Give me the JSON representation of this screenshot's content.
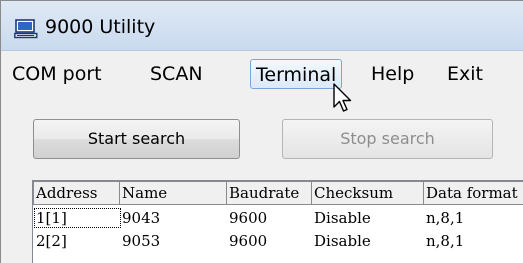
{
  "window": {
    "title": "9000 Utility",
    "app_icon": "computer-icon"
  },
  "menu": {
    "items": [
      {
        "label": "COM port"
      },
      {
        "label": "SCAN"
      },
      {
        "label": "Terminal",
        "hovered": true
      },
      {
        "label": "Help"
      },
      {
        "label": "Exit"
      }
    ]
  },
  "toolbar": {
    "start_label": "Start search",
    "stop_label": "Stop search",
    "stop_enabled": false
  },
  "table": {
    "columns": [
      "Address",
      "Name",
      "Baudrate",
      "Checksum",
      "Data format"
    ],
    "rows": [
      [
        "1[1]",
        "9043",
        "9600",
        "Disable",
        "n,8,1"
      ],
      [
        "2[2]",
        "9053",
        "9600",
        "Disable",
        "n,8,1"
      ]
    ]
  },
  "cursor": {
    "icon": "arrow-cursor-icon"
  }
}
